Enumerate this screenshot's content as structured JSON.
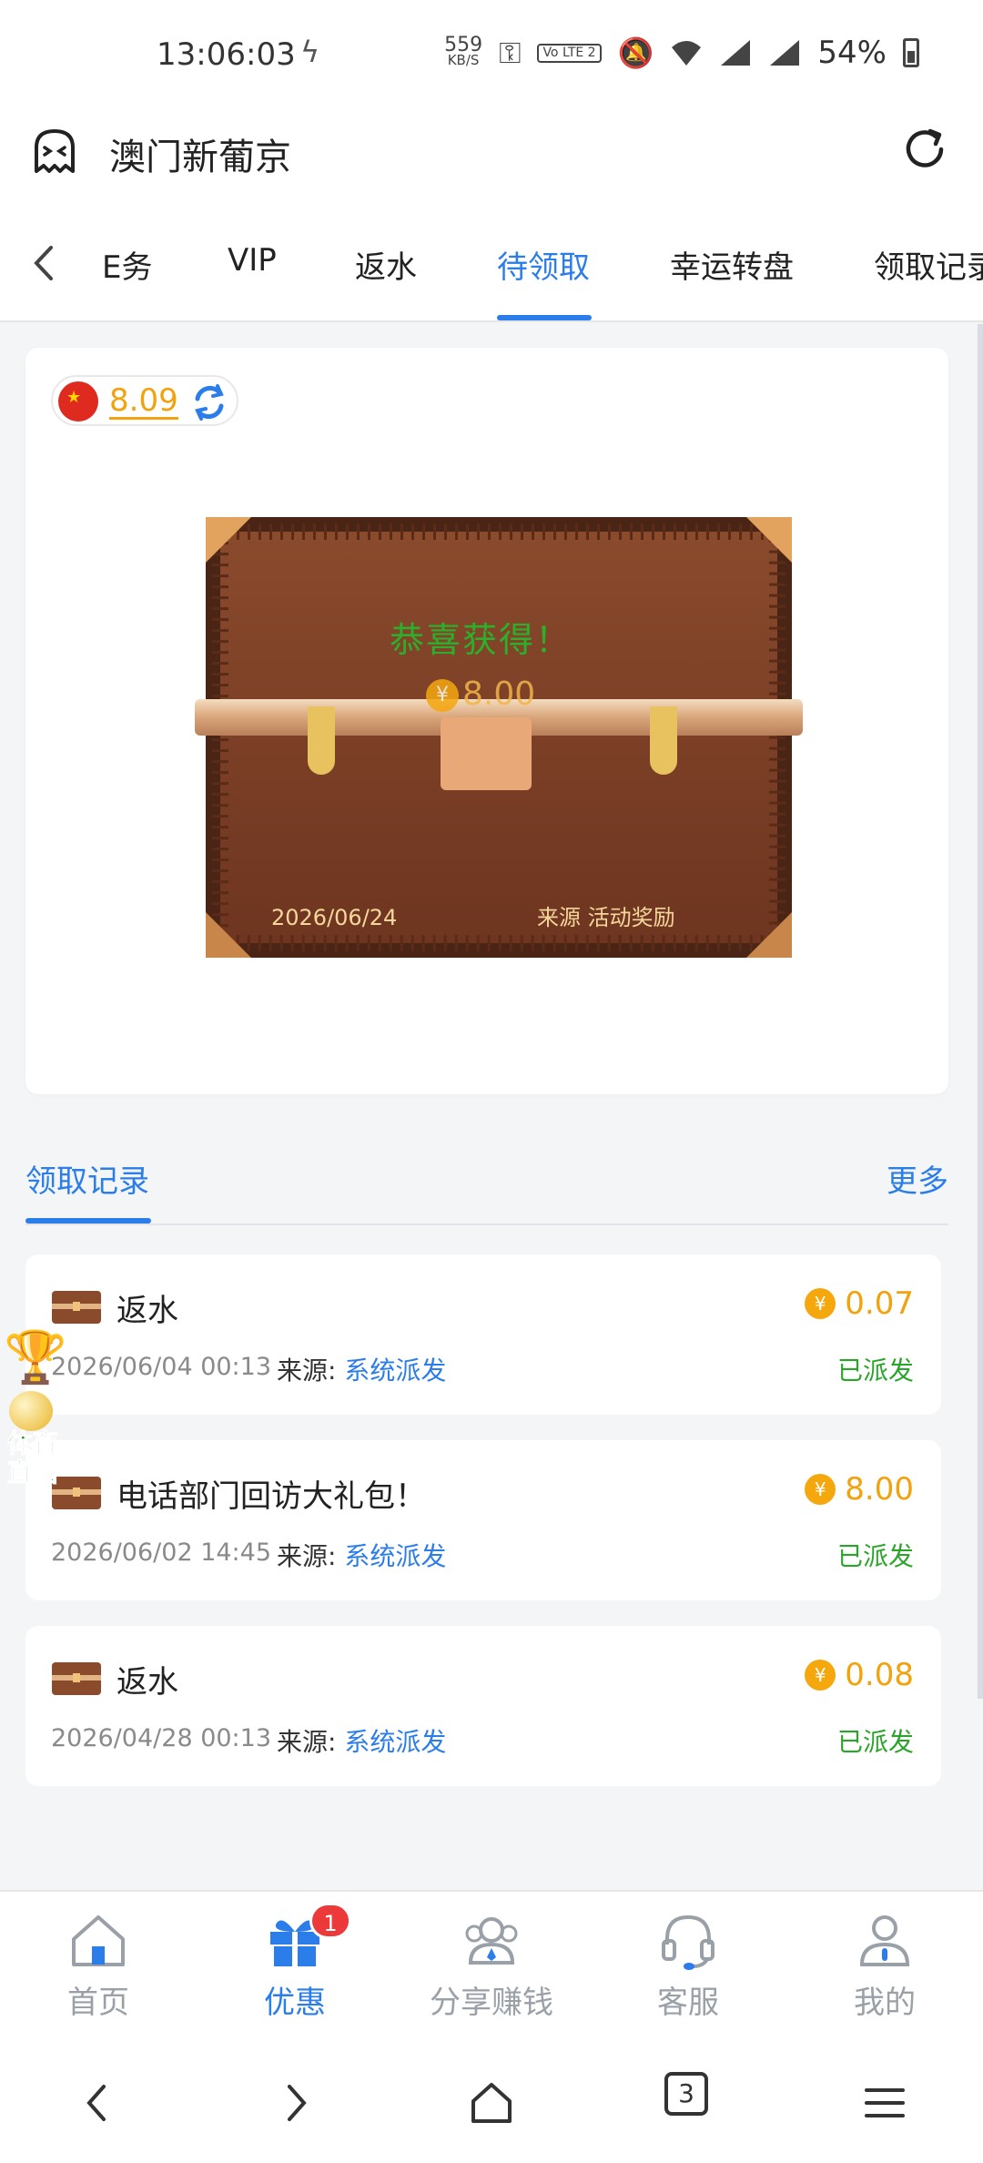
{
  "status_bar": {
    "time": "13:06:03",
    "net_speed_value": "559",
    "net_speed_unit": "KB/S",
    "volte_label": "Vo LTE 2",
    "battery_percent": "54%"
  },
  "header": {
    "title": "澳门新葡京"
  },
  "tabs": [
    {
      "label": "E务"
    },
    {
      "label": "VIP"
    },
    {
      "label": "返水"
    },
    {
      "label": "待领取",
      "active": true
    },
    {
      "label": "幸运转盘"
    },
    {
      "label": "领取记录"
    }
  ],
  "card": {
    "balance": "8.09",
    "congrats_text": "恭喜获得！",
    "prize_amount": "8.00",
    "date": "2026/06/24",
    "source_text": "来源  活动奖励"
  },
  "records": {
    "title": "领取记录",
    "more": "更多",
    "source_label": "来源:",
    "items": [
      {
        "name": "返水",
        "amount": "0.07",
        "date": "2026/06/04 00:13",
        "source": "系统派发",
        "status": "已派发"
      },
      {
        "name": "电话部门回访大礼包！",
        "amount": "8.00",
        "date": "2026/06/02 14:45",
        "source": "系统派发",
        "status": "已派发"
      },
      {
        "name": "返水",
        "amount": "0.08",
        "date": "2026/04/28 00:13",
        "source": "系统派发",
        "status": "已派发"
      }
    ]
  },
  "float_badge": {
    "text": "体育直播"
  },
  "bottom_nav": {
    "badge_count": "1",
    "items": [
      {
        "label": "首页"
      },
      {
        "label": "优惠",
        "active": true
      },
      {
        "label": "分享赚钱"
      },
      {
        "label": "客服"
      },
      {
        "label": "我的"
      }
    ]
  },
  "browser_nav": {
    "tab_count": "3"
  },
  "colors": {
    "accent": "#2b7de9",
    "amount": "#f2a20c",
    "status_ok": "#2aa52a",
    "badge": "#ec3a3a"
  }
}
